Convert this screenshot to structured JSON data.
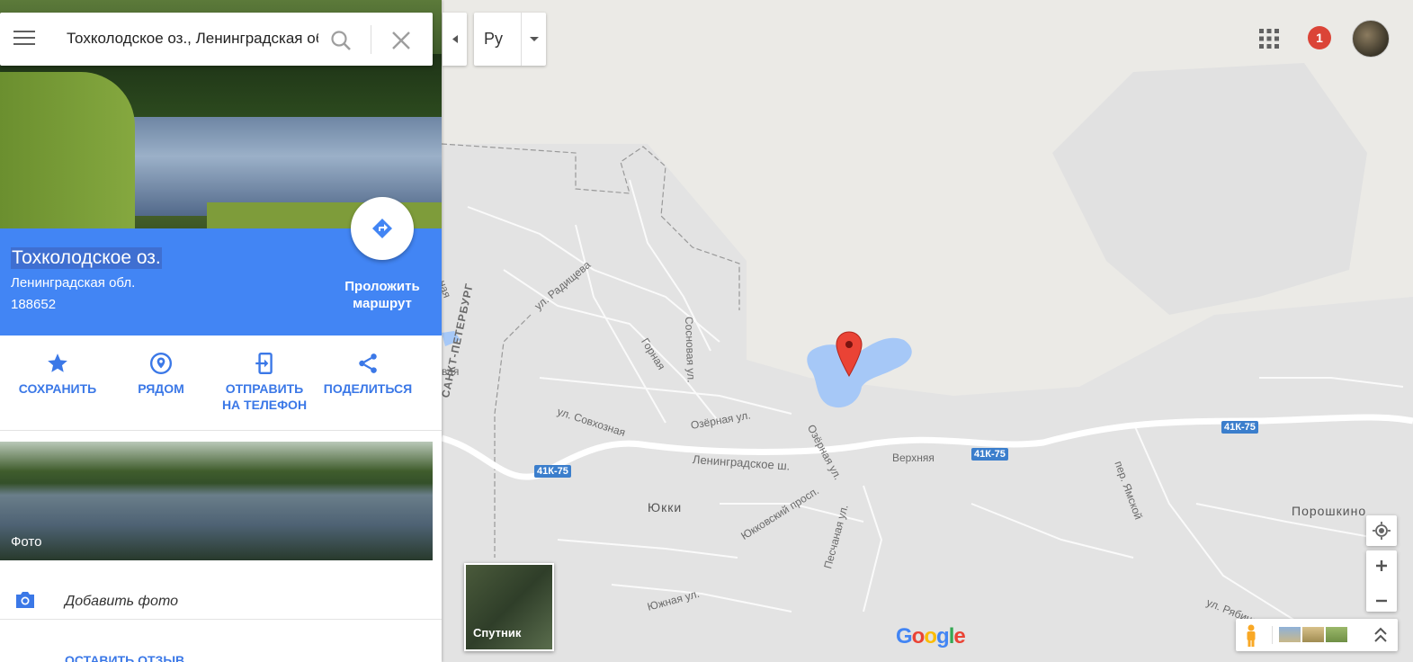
{
  "search": {
    "value": "Тохколодское оз., Ленинградская обл.",
    "placeholder": ""
  },
  "place": {
    "title": "Тохколодское оз.",
    "region": "Ленинградская обл.",
    "postal_code": "188652",
    "route_label_1": "Проложить",
    "route_label_2": "маршрут"
  },
  "actions": [
    {
      "label_1": "СОХРАНИТЬ",
      "label_2": "",
      "icon": "star-icon"
    },
    {
      "label_1": "РЯДОМ",
      "label_2": "",
      "icon": "location-pin-icon"
    },
    {
      "label_1": "ОТПРАВИТЬ",
      "label_2": "НА ТЕЛЕФОН",
      "icon": "send-to-phone-icon"
    },
    {
      "label_1": "ПОДЕЛИТЬСЯ",
      "label_2": "",
      "icon": "share-icon"
    }
  ],
  "photo": {
    "label": "Фото"
  },
  "add_photo": {
    "label": "Добавить фото"
  },
  "review": {
    "label": "ОСТАВИТЬ ОТЗЫВ"
  },
  "language": {
    "code": "Ру"
  },
  "notifications": {
    "count": "1"
  },
  "satellite": {
    "label": "Спутник"
  },
  "branding": {
    "logo": "Google"
  },
  "map_labels": {
    "street_radishcheva": "ул. Радищева",
    "street_gornaya": "Горная",
    "street_sosnovaya": "Сосновая ул.",
    "street_spb": "САНКТ-ПЕТЕРБУРГ",
    "street_sovkhoznaya": "ул. Совхозная",
    "street_ozernaya1": "Озёрная ул.",
    "street_ozernaya2": "Озёрная ул.",
    "street_leningradskoe": "Ленинградское ш.",
    "street_verkhnyaya": "Верхняя",
    "street_yamskoy": "пер. Ямской",
    "street_yukkovsky": "Юкковский просп.",
    "street_peschanaya": "Песчаная ул.",
    "street_yuzhnaya": "Южная ул.",
    "street_ryabinovaya": "ул. Рябиновая",
    "village_yukki": "Юкки",
    "village_poroshkino": "Порошкино",
    "edge_1": "ная",
    "edge_2": "вая",
    "road_1": "41К-75",
    "road_2": "41К-75",
    "road_3": "41К-75"
  },
  "colors": {
    "accent": "#4285f4",
    "action": "#3b78e7",
    "marker": "#ea4335",
    "water": "#a6c8f7",
    "map_bg": "#ebeae6"
  }
}
